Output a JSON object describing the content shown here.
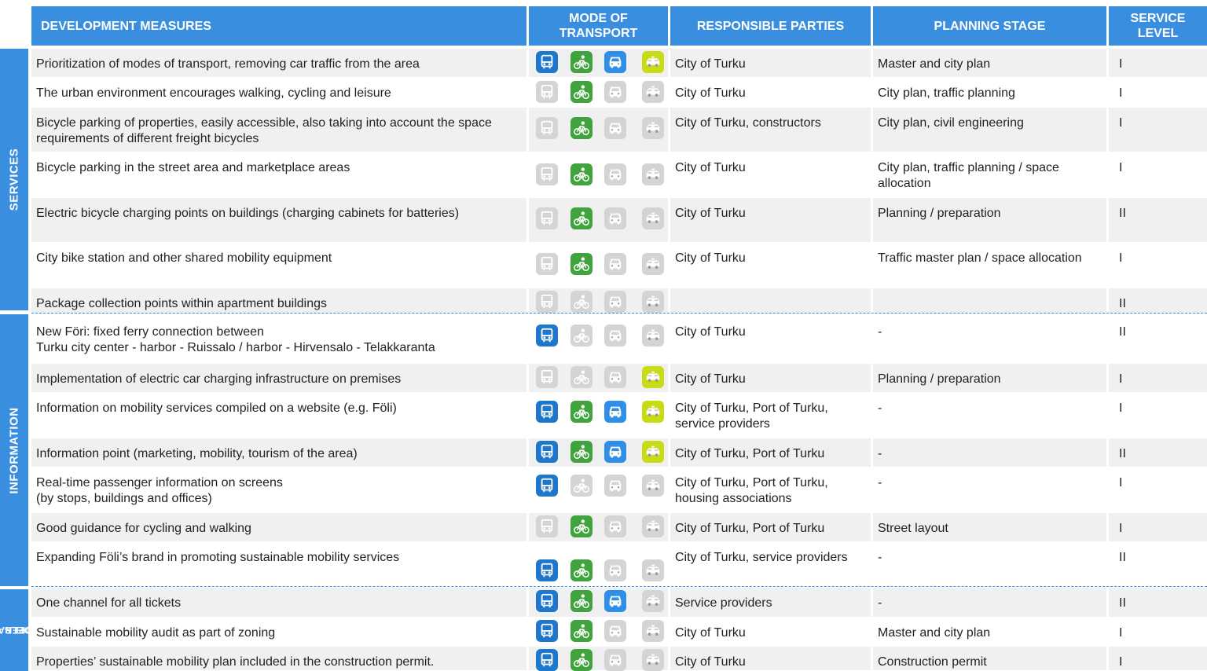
{
  "headers": {
    "measures": "DEVELOPMENT MEASURES",
    "mode_line1": "MODE OF",
    "mode_line2": "TRANSPORT",
    "responsible": "RESPONSIBLE PARTIES",
    "stage": "PLANNING STAGE",
    "level_line1": "SERVICE",
    "level_line2": "LEVEL"
  },
  "sections": {
    "services": "SERVICES",
    "information": "INFORMATION",
    "operating_line1": "OPERATING",
    "operating_line2": "MODELS"
  },
  "colors": {
    "header": "#3a8ee0",
    "bus": "#1f77cc",
    "bike": "#41a33e",
    "car": "#2f8fe8",
    "taxi": "#c8dc16",
    "inactive": "#d4d4d4"
  },
  "icon_names": [
    "bus-icon",
    "bicycle-icon",
    "car-icon",
    "taxi-icon"
  ],
  "rows": [
    {
      "measure": "Prioritization of modes of transport, removing car traffic from the area",
      "modes": [
        1,
        1,
        1,
        1
      ],
      "responsible": "City of Turku",
      "stage": "Master and city plan",
      "level": "I"
    },
    {
      "measure": "The urban environment encourages walking, cycling and leisure",
      "modes": [
        0,
        1,
        0,
        0
      ],
      "responsible": "City of Turku",
      "stage": "City plan, traffic planning",
      "level": "I"
    },
    {
      "measure": "Bicycle parking of properties, easily accessible, also taking into account the space requirements of different freight bicycles",
      "modes": [
        0,
        1,
        0,
        0
      ],
      "responsible": "City of Turku, constructors",
      "stage": "City plan, civil engineering",
      "level": "I"
    },
    {
      "measure": "Bicycle parking in the street area and marketplace areas",
      "modes": [
        0,
        1,
        0,
        0
      ],
      "responsible": "City of Turku",
      "stage": "City plan, traffic planning / space allocation",
      "level": "I"
    },
    {
      "measure": "Electric bicycle charging points on buildings (charging cabinets for batteries)",
      "modes": [
        0,
        1,
        0,
        0
      ],
      "responsible": "City of Turku",
      "stage": "Planning / preparation",
      "level": "II"
    },
    {
      "measure": "City bike station and other shared mobility equipment",
      "modes": [
        0,
        1,
        0,
        0
      ],
      "responsible": "City of Turku",
      "stage": "Traffic master plan / space allocation",
      "level": "I"
    },
    {
      "measure": "Package collection points within apartment buildings",
      "modes": [
        0,
        0,
        0,
        0
      ],
      "responsible": "",
      "stage": "",
      "level": "II"
    },
    {
      "measure": "New Föri: fixed ferry connection between\nTurku city center - harbor - Ruissalo / harbor - Hirvensalo - Telakkaranta",
      "modes": [
        1,
        0,
        0,
        0
      ],
      "responsible": "City of Turku",
      "stage": "-",
      "level": "II"
    },
    {
      "measure": "Implementation of electric car charging infrastructure on premises",
      "modes": [
        0,
        0,
        0,
        1
      ],
      "responsible": "City of Turku",
      "stage": "Planning / preparation",
      "level": "I"
    },
    {
      "measure": "Information on mobility services compiled on a website (e.g. Föli)",
      "modes": [
        1,
        1,
        1,
        1
      ],
      "responsible": "City of Turku, Port of Turku, service providers",
      "stage": "-",
      "level": "I"
    },
    {
      "measure": "Information point (marketing, mobility, tourism of the area)",
      "modes": [
        1,
        1,
        1,
        1
      ],
      "responsible": "City of Turku, Port of Turku",
      "stage": "-",
      "level": "II"
    },
    {
      "measure": "Real-time passenger information on screens\n(by stops, buildings and offices)",
      "modes": [
        1,
        0,
        0,
        0
      ],
      "responsible": "City of Turku, Port of Turku, housing associations",
      "stage": "-",
      "level": "I"
    },
    {
      "measure": "Good guidance for cycling and walking",
      "modes": [
        0,
        1,
        0,
        0
      ],
      "responsible": "City of Turku, Port of Turku",
      "stage": "Street layout",
      "level": "I"
    },
    {
      "measure": "Expanding Föli’s brand in promoting sustainable mobility services",
      "modes": [
        1,
        1,
        0,
        0
      ],
      "responsible": "City of Turku, service providers",
      "stage": "-",
      "level": "II"
    },
    {
      "measure": "One channel for all tickets",
      "modes": [
        1,
        1,
        1,
        0
      ],
      "responsible": "Service providers",
      "stage": "-",
      "level": "II"
    },
    {
      "measure": "Sustainable mobility audit as part of zoning",
      "modes": [
        1,
        1,
        0,
        0
      ],
      "responsible": "City of Turku",
      "stage": "Master and city plan",
      "level": "I"
    },
    {
      "measure": "Properties’ sustainable mobility plan included in the construction permit.",
      "modes": [
        1,
        1,
        0,
        0
      ],
      "responsible": "City of Turku",
      "stage": "Construction permit",
      "level": "I"
    }
  ]
}
